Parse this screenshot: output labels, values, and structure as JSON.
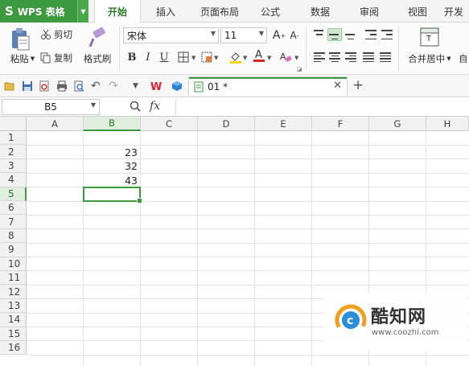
{
  "app": {
    "name": "WPS 表格",
    "logo_letter": "S"
  },
  "tabs": [
    {
      "label": "开始",
      "active": true
    },
    {
      "label": "插入"
    },
    {
      "label": "页面布局"
    },
    {
      "label": "公式"
    },
    {
      "label": "数据"
    },
    {
      "label": "审阅"
    },
    {
      "label": "视图"
    },
    {
      "label": "开发"
    }
  ],
  "ribbon": {
    "paste": "粘贴",
    "cut": "剪切",
    "copy": "复制",
    "format_painter": "格式刷",
    "font_name": "宋体",
    "font_size": "11",
    "bold": "B",
    "italic": "I",
    "underline": "U",
    "merge_center": "合并居中",
    "auto_wrap": "自"
  },
  "document": {
    "tab_name": "01 *"
  },
  "formula_bar": {
    "cell_ref": "B5",
    "fx": "fx",
    "value": ""
  },
  "sheet": {
    "columns": [
      "A",
      "B",
      "C",
      "D",
      "E",
      "F",
      "G",
      "H"
    ],
    "rows": [
      "1",
      "2",
      "3",
      "4",
      "5",
      "6",
      "7",
      "8",
      "9",
      "10",
      "11",
      "12",
      "13",
      "14",
      "15",
      "16"
    ],
    "selected_cell": "B5",
    "cells": {
      "B2": "23",
      "B3": "32",
      "B4": "43"
    }
  },
  "watermark": {
    "title": "酷知网",
    "url": "www.coozhi.com"
  },
  "colors": {
    "accent": "#3e9a3e",
    "selection_fill": "#e0eedd"
  }
}
